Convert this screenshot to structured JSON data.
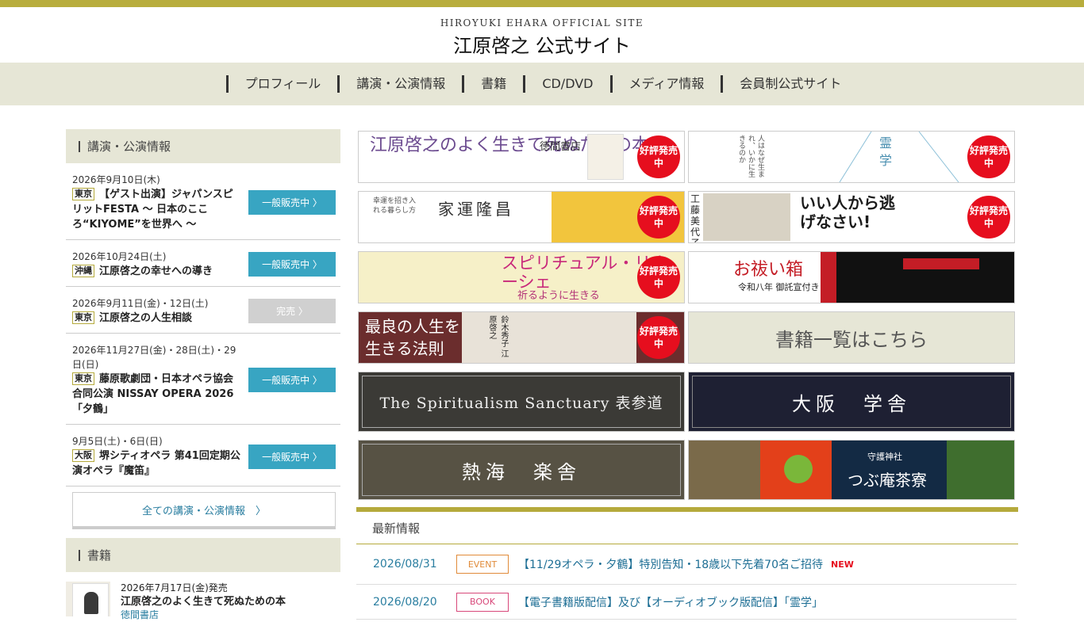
{
  "site": {
    "en_title": "HIROYUKI EHARA OFFICIAL SITE",
    "ja_title": "江原啓之 公式サイト"
  },
  "nav": [
    "プロフィール",
    "講演・公演情報",
    "書籍",
    "CD/DVD",
    "メディア情報",
    "会員制公式サイト"
  ],
  "events_section": {
    "heading": "講演・公演情報",
    "events": [
      {
        "date": "2026年9月10日(木)",
        "pref": "東京",
        "title": "【ゲスト出演】ジャパンスピリットFESTA 〜 日本のこころ“KIYOME”を世界へ 〜",
        "button": "一般販売中 〉"
      },
      {
        "date": "2026年10月24日(土)",
        "pref": "沖縄",
        "title": "江原啓之の幸せへの導き",
        "button": "一般販売中 〉"
      },
      {
        "date": "2026年9月11日(金)・12日(土)",
        "pref": "東京",
        "title": "江原啓之の人生相談",
        "button": "完売 〉"
      },
      {
        "date": "2026年11月27日(金)・28日(土)・29日(日)",
        "pref": "東京",
        "title": "藤原歌劇団・日本オペラ協会合同公演 NISSAY OPERA 2026 「夕鶴」",
        "button": "一般販売中 〉"
      },
      {
        "date": "9月5日(土)・6日(日)",
        "pref": "大阪",
        "title": "堺シティオペラ 第41回定期公演オペラ『魔笛』",
        "button": "一般販売中 〉"
      }
    ],
    "all_link": "全ての講演・公演情報　〉"
  },
  "books_section": {
    "heading": "書籍",
    "item": {
      "date": "2026年7月17日(金)発売",
      "title": "江原啓之のよく生きて死ぬための本",
      "publisher": "徳間書店"
    }
  },
  "banners": [
    {
      "title": "江原啓之のよく生きて死ぬための本",
      "sub": "徳間書店",
      "badge": "好評発売中"
    },
    {
      "title": "霊学",
      "sub": "人はなぜ生まれ、いかに生きるのか",
      "badge": "好評発売中"
    },
    {
      "title": "家運隆昌",
      "sub": "幸運を招き入れる暮らし方",
      "badge": "好評発売中"
    },
    {
      "title": "いい人から逃げなさい!",
      "sub": "工藤美代子 江原啓之",
      "badge": "好評発売中"
    },
    {
      "title": "スピリチュアル・リナーシェ",
      "sub": "祈るように生きる",
      "badge": "好評発売中"
    },
    {
      "title": "お祓い箱",
      "sub": "令和八年 御託宣付き",
      "badge": "好評発売中"
    },
    {
      "title": "最良の人生を生きる法則",
      "sub": "鈴木秀子 江原啓之",
      "badge": "好評発売中"
    },
    {
      "title": "書籍一覧はこちら",
      "sub": "",
      "badge": ""
    },
    {
      "title": "The Spiritualism Sanctuary 表参道",
      "sub": "",
      "badge": ""
    },
    {
      "title": "大阪　学舎",
      "sub": "",
      "badge": ""
    },
    {
      "title": "熱海　楽舎",
      "sub": "",
      "badge": ""
    },
    {
      "title": "つぶ庵茶寮",
      "sub": "守護神社",
      "badge": ""
    }
  ],
  "news": {
    "heading": "最新情報",
    "items": [
      {
        "date": "2026/08/31",
        "category": "EVENT",
        "title": "【11/29オペラ・夕鶴】特別告知・18歳以下先着70名ご招待",
        "new": "NEW"
      },
      {
        "date": "2026/08/20",
        "category": "BOOK",
        "title": "【電子書籍版配信】及び【オーディオブック版配信】「霊学」",
        "new": ""
      }
    ]
  }
}
